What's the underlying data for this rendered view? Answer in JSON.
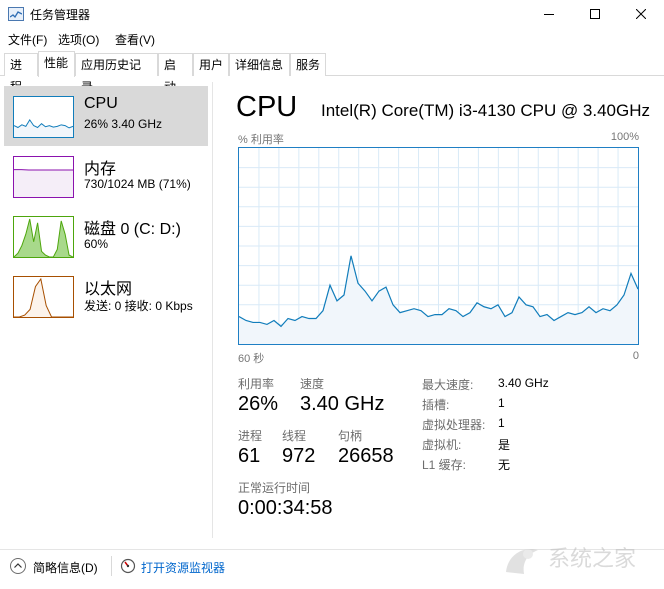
{
  "window": {
    "title": "任务管理器",
    "icons": {
      "app": "task-manager-icon",
      "minimize": "minimize-icon",
      "maximize": "maximize-icon",
      "close": "close-icon"
    }
  },
  "menu": [
    "文件(F)",
    "选项(O)",
    "查看(V)"
  ],
  "tabs": [
    "进程",
    "性能",
    "应用历史记录",
    "启动",
    "用户",
    "详细信息",
    "服务"
  ],
  "active_tab": "性能",
  "resources": [
    {
      "name": "CPU",
      "detail": "26% 3.40 GHz",
      "color": "#117dbb",
      "selected": true
    },
    {
      "name": "内存",
      "detail": "730/1024 MB (71%)",
      "color": "#8b12ae",
      "selected": false
    },
    {
      "name": "磁盘 0 (C: D:)",
      "detail": "60%",
      "color": "#4da60c",
      "selected": false
    },
    {
      "name": "以太网",
      "detail": "发送: 0 接收: 0 Kbps",
      "color": "#a74f01",
      "selected": false
    }
  ],
  "cpu": {
    "title": "CPU",
    "model": "Intel(R) Core(TM) i3-4130 CPU @ 3.40GHz",
    "graph_label": "% 利用率",
    "graph_max": "100%",
    "time_span": "60 秒",
    "time_end": "0",
    "utilization_history_percent": [
      14,
      12,
      11,
      11,
      10,
      12,
      9,
      13,
      12,
      14,
      13,
      13,
      17,
      30,
      22,
      25,
      45,
      31,
      27,
      22,
      27,
      29,
      20,
      16,
      17,
      18,
      17,
      14,
      15,
      15,
      18,
      17,
      14,
      16,
      21,
      19,
      18,
      20,
      14,
      16,
      24,
      20,
      19,
      14,
      15,
      12,
      14,
      16,
      15,
      16,
      19,
      16,
      18,
      17,
      20,
      25,
      36,
      28
    ],
    "stats": {
      "utilization_label": "利用率",
      "utilization": "26%",
      "speed_label": "速度",
      "speed": "3.40 GHz",
      "processes_label": "进程",
      "processes": "61",
      "threads_label": "线程",
      "threads": "972",
      "handles_label": "句柄",
      "handles": "26658",
      "uptime_label": "正常运行时间",
      "uptime": "0:00:34:58"
    },
    "specs": [
      {
        "label": "最大速度:",
        "value": "3.40 GHz"
      },
      {
        "label": "插槽:",
        "value": "1"
      },
      {
        "label": "虚拟处理器:",
        "value": "1"
      },
      {
        "label": "虚拟机:",
        "value": "是"
      },
      {
        "label": "L1 缓存:",
        "value": "无"
      }
    ]
  },
  "thumbnails": {
    "cpu": [
      30,
      25,
      32,
      28,
      45,
      30,
      25,
      35,
      27,
      30,
      26,
      28,
      32,
      30,
      24,
      28
    ],
    "memory": [
      72,
      72,
      71,
      71,
      71,
      71,
      71,
      71,
      71
    ],
    "disk": [
      0,
      10,
      30,
      60,
      100,
      40,
      90,
      15,
      5,
      0,
      0,
      20,
      95,
      60,
      5,
      0
    ],
    "ethernet": [
      0,
      0,
      5,
      20,
      80,
      100,
      30,
      0,
      0,
      0,
      0,
      0
    ]
  },
  "footer": {
    "fewer_details": "简略信息(D)",
    "open_monitor": "打开资源监视器",
    "icons": {
      "fewer": "chevron-up-icon",
      "monitor": "resource-monitor-icon"
    }
  },
  "watermark": "系统之家"
}
